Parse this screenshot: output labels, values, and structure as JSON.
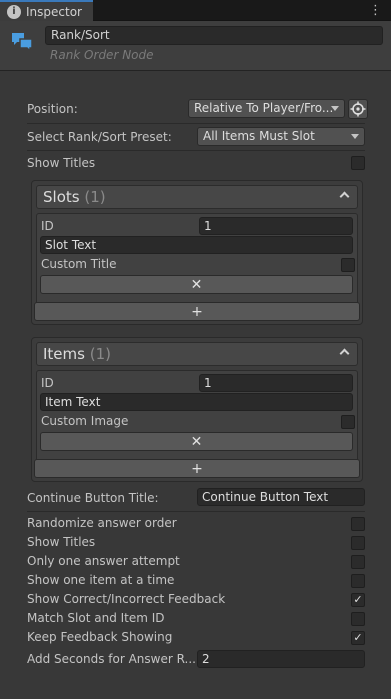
{
  "tab": {
    "label": "Inspector"
  },
  "header": {
    "name": "Rank/Sort",
    "subtitle": "Rank Order Node"
  },
  "position": {
    "label": "Position:",
    "value": "Relative To Player/Fro..."
  },
  "preset": {
    "label": "Select Rank/Sort Preset:",
    "value": "All Items Must Slot"
  },
  "show_titles_top": {
    "label": "Show Titles",
    "checked": false
  },
  "slots": {
    "title": "Slots",
    "count": "(1)",
    "id_label": "ID",
    "id_value": "1",
    "text_value": "Slot Text",
    "custom_label": "Custom Title",
    "custom_checked": false,
    "remove_glyph": "✕",
    "add_glyph": "+"
  },
  "items": {
    "title": "Items",
    "count": "(1)",
    "id_label": "ID",
    "id_value": "1",
    "text_value": "Item Text",
    "custom_label": "Custom Image",
    "custom_checked": false,
    "remove_glyph": "✕",
    "add_glyph": "+"
  },
  "continue": {
    "label": "Continue Button Title:",
    "value": "Continue Button Text"
  },
  "toggles": [
    {
      "label": "Randomize answer order",
      "checked": false,
      "mark": ""
    },
    {
      "label": "Show Titles",
      "checked": false,
      "mark": ""
    },
    {
      "label": "Only one answer attempt",
      "checked": false,
      "mark": ""
    },
    {
      "label": "Show one item at a time",
      "checked": false,
      "mark": ""
    },
    {
      "label": "Show Correct/Incorrect Feedback",
      "checked": true,
      "mark": "✓"
    },
    {
      "label": "Match Slot and Item ID",
      "checked": false,
      "mark": ""
    },
    {
      "label": "Keep Feedback Showing",
      "checked": true,
      "mark": "✓"
    }
  ],
  "seconds": {
    "label": "Add Seconds for Answer R...",
    "value": "2"
  },
  "colors": {
    "accent": "#3a79bb",
    "node_icon": "#4a9de0"
  },
  "icons": {
    "tab": "info-icon",
    "header": "chat-bubbles-icon",
    "position": "crosshair-icon",
    "menu": "kebab-menu-icon"
  }
}
